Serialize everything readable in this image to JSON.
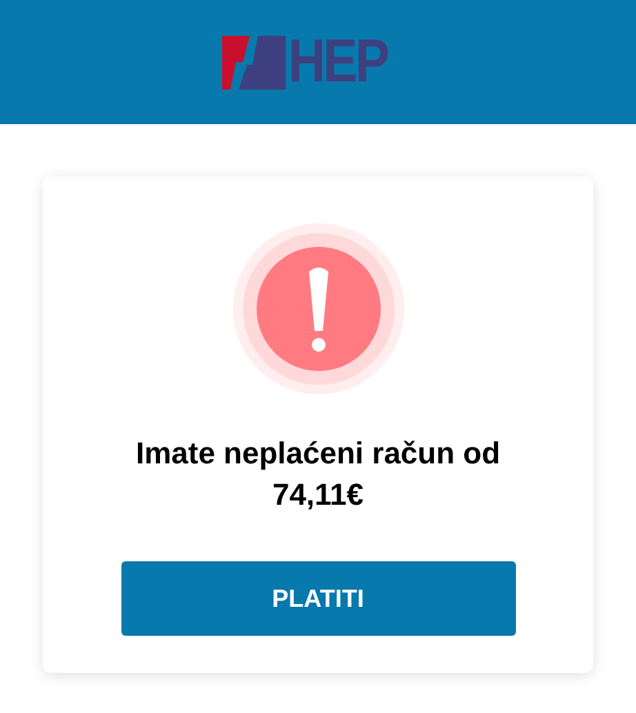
{
  "header": {
    "logo_text": "HEP"
  },
  "card": {
    "message": "Imate neplaćeni račun od 74,11€",
    "button": "PLATITI"
  }
}
